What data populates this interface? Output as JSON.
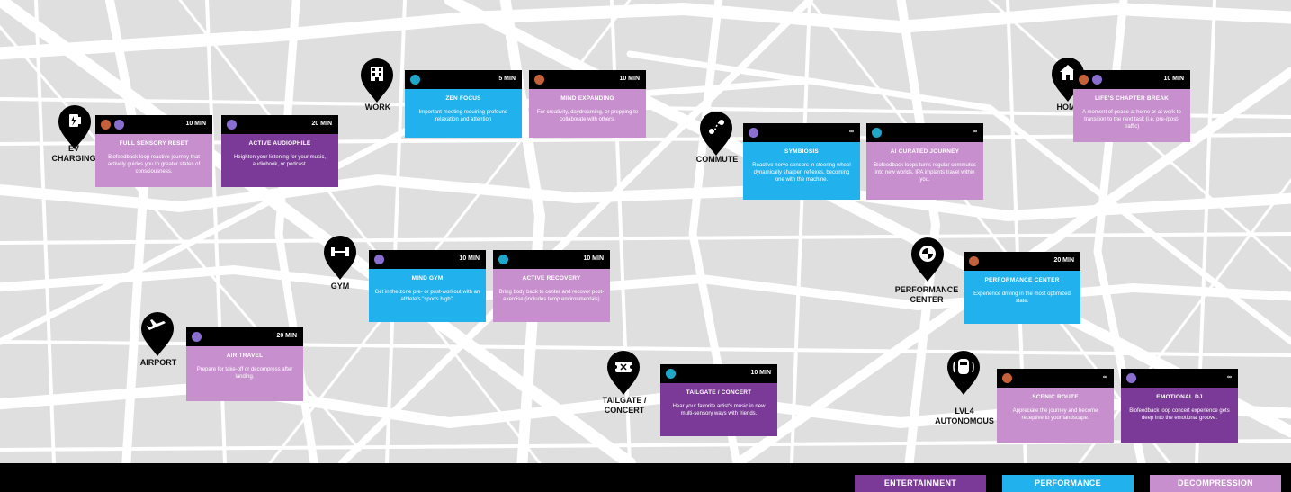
{
  "colors": {
    "entertainment": "#7b3a97",
    "performance": "#21b1ec",
    "decompression": "#c78fcd",
    "map_bg": "#dfdfdf",
    "road": "#ffffff"
  },
  "locations": [
    {
      "id": "ev",
      "label": "EV\nCHARGING",
      "icon": "ev-charger-icon"
    },
    {
      "id": "work",
      "label": "WORK",
      "icon": "office-building-icon"
    },
    {
      "id": "commute",
      "label": "COMMUTE",
      "icon": "route-icon"
    },
    {
      "id": "home",
      "label": "HOME",
      "icon": "house-icon"
    },
    {
      "id": "gym",
      "label": "GYM",
      "icon": "dumbbell-icon"
    },
    {
      "id": "perf",
      "label": "PERFORMANCE\nCENTER",
      "icon": "bmw-logo-icon"
    },
    {
      "id": "airport",
      "label": "AIRPORT",
      "icon": "airplane-icon"
    },
    {
      "id": "tailgate",
      "label": "TAILGATE /\nCONCERT",
      "icon": "ticket-icon"
    },
    {
      "id": "lvl4",
      "label": "LVL4\nAUTONOMOUS",
      "icon": "autonomous-car-icon"
    }
  ],
  "cards": [
    {
      "id": "full-sensory-reset",
      "category": "decompression",
      "duration": "10 MIN",
      "title": "FULL SENSORY RESET",
      "desc": "Biofeedback loop reactive journey that actively guides you to greater states of consciousness."
    },
    {
      "id": "active-audiophile",
      "category": "entertainment",
      "duration": "20 MIN",
      "title": "ACTIVE AUDIOPHILE",
      "desc": "Heighten your listening for your music, audiobook, or podcast."
    },
    {
      "id": "zen-focus",
      "category": "performance",
      "duration": "5 MIN",
      "title": "ZEN FOCUS",
      "desc": "Important meeting requiring profound relaxation and attention"
    },
    {
      "id": "mind-expanding",
      "category": "decompression",
      "duration": "10 MIN",
      "title": "MIND EXPANDING",
      "desc": "For creativity, daydreaming, or prepping to collaborate with others."
    },
    {
      "id": "symbiosis",
      "category": "performance",
      "duration": "∞",
      "title": "SYMBIOSIS",
      "desc": "Reactive nerve sensors in steering wheel dynamically sharpen reflexes, becoming one with the machine."
    },
    {
      "id": "ai-curated-journey",
      "category": "decompression",
      "duration": "∞",
      "title": "AI CURATED JOURNEY",
      "desc": "Biofeedback loops turns regular commutes into new worlds, IPA implants travel within you."
    },
    {
      "id": "lifes-chapter-break",
      "category": "decompression",
      "duration": "10 MIN",
      "title": "LIFE'S CHAPTER BREAK",
      "desc": "A moment of peace at home or at work to transition to the next task (i.e. pre-/post-traffic)"
    },
    {
      "id": "mind-gym",
      "category": "performance",
      "duration": "10 MIN",
      "title": "MIND GYM",
      "desc": "Get in the zone pre- or post-workout with an athlete's \"sports high\"."
    },
    {
      "id": "active-recovery",
      "category": "decompression",
      "duration": "10 MIN",
      "title": "ACTIVE RECOVERY",
      "desc": "Bring body back to center and recover post-exercise (includes temp environmentals)"
    },
    {
      "id": "performance-center",
      "category": "performance",
      "duration": "20 MIN",
      "title": "PERFORMANCE CENTER",
      "desc": "Experience driving in the most optimized state."
    },
    {
      "id": "air-travel",
      "category": "decompression",
      "duration": "20 MIN",
      "title": "AIR TRAVEL",
      "desc": "Prepare for take-off or decompress after landing."
    },
    {
      "id": "tailgate-concert",
      "category": "entertainment",
      "duration": "10 MIN",
      "title": "TAILGATE / CONCERT",
      "desc": "Hear your favorite artist's music in new multi-sensory ways with friends."
    },
    {
      "id": "scenic-route",
      "category": "decompression",
      "duration": "∞",
      "title": "SCENIC ROUTE",
      "desc": "Appreciate the journey and become receptive to your landscape."
    },
    {
      "id": "emotional-dj",
      "category": "entertainment",
      "duration": "∞",
      "title": "EMOTIONAL DJ",
      "desc": "Biofeedback loop concert experience gets deep into the emotional groove."
    }
  ],
  "legend": [
    {
      "id": "entertainment",
      "label": "ENTERTAINMENT"
    },
    {
      "id": "performance",
      "label": "PERFORMANCE"
    },
    {
      "id": "decompression",
      "label": "DECOMPRESSION"
    }
  ]
}
